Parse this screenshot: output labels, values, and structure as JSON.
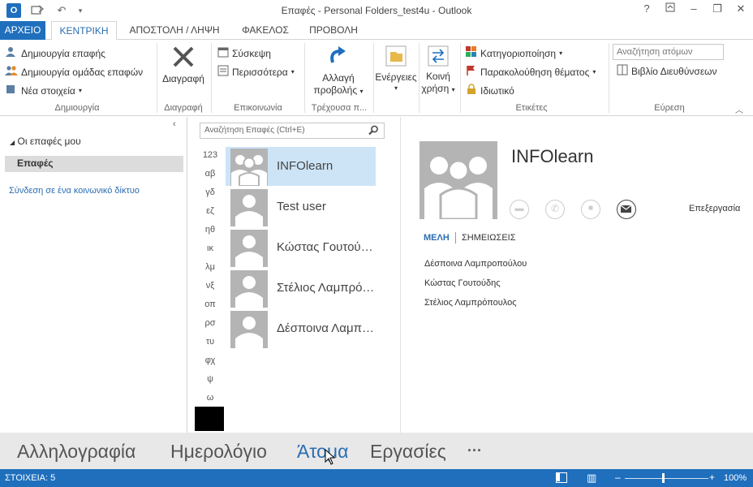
{
  "titlebar": {
    "title": "Επαφές - Personal Folders_test4u - Outlook",
    "help": "?",
    "minimize": "–",
    "restore": "❐",
    "close": "✕"
  },
  "tabs": {
    "file": "ΑΡΧΕΙΟ",
    "home": "ΚΕΝΤΡΙΚΗ",
    "send_receive": "ΑΠΟΣΤΟΛΗ / ΛΗΨΗ",
    "folder": "ΦΑΚΕΛΟΣ",
    "view": "ΠΡΟΒΟΛΗ"
  },
  "ribbon": {
    "new_contact": "Δημιουργία επαφής",
    "new_group": "Δημιουργία ομάδας επαφών",
    "new_items": "Νέα στοιχεία",
    "group_new": "Δημιουργία",
    "delete": "Διαγραφή",
    "group_delete": "Διαγραφή",
    "meeting": "Σύσκεψη",
    "more": "Περισσότερα",
    "group_communicate": "Επικοινωνία",
    "change_view_1": "Αλλαγή",
    "change_view_2": "προβολής",
    "group_current_view": "Τρέχουσα π...",
    "actions": "Ενέργειες",
    "share_1": "Κοινή",
    "share_2": "χρήση",
    "categorize": "Κατηγοριοποίηση",
    "follow_up": "Παρακολούθηση θέματος",
    "private": "Ιδιωτικό",
    "group_tags": "Ετικέτες",
    "search_people_placeholder": "Αναζήτηση ατόμων",
    "address_book": "Βιβλίο Διευθύνσεων",
    "group_find": "Εύρεση"
  },
  "folders": {
    "my_contacts": "Οι επαφές μου",
    "contacts": "Επαφές",
    "connect_social": "Σύνδεση σε ένα κοινωνικό δίκτυο"
  },
  "search": {
    "placeholder": "Αναζήτηση Επαφές (Ctrl+E)"
  },
  "alphabet": [
    "123",
    "αβ",
    "γδ",
    "εζ",
    "ηθ",
    "ικ",
    "λμ",
    "νξ",
    "οπ",
    "ρσ",
    "τυ",
    "φχ",
    "ψ",
    "ω"
  ],
  "contacts": [
    {
      "name": "INFOlearn",
      "selected": true
    },
    {
      "name": "Test user",
      "selected": false
    },
    {
      "name": "Κώστας Γουτούδης",
      "selected": false
    },
    {
      "name": "Στέλιος Λαμπρόπουλος",
      "selected": false
    },
    {
      "name": "Δέσποινα Λαμπροπούλου",
      "selected": false
    }
  ],
  "reading": {
    "name": "INFOlearn",
    "edit": "Επεξεργασία",
    "tab_members": "ΜΕΛΗ",
    "tab_notes": "ΣΗΜΕΙΩΣΕΙΣ",
    "members": [
      "Δέσποινα Λαμπροπούλου",
      "Κώστας Γουτούδης",
      "Στέλιος Λαμπρόπουλος"
    ]
  },
  "navbar": {
    "mail": "Αλληλογραφία",
    "calendar": "Ημερολόγιο",
    "people": "Άτομα",
    "tasks": "Εργασίες",
    "more": "···"
  },
  "status": {
    "items": "ΣΤΟΙΧΕΙΑ: 5",
    "zoom": "100%"
  },
  "colors": {
    "accent": "#1f6fbd",
    "selected": "#cde4f7",
    "avatar": "#b4b4b4"
  }
}
